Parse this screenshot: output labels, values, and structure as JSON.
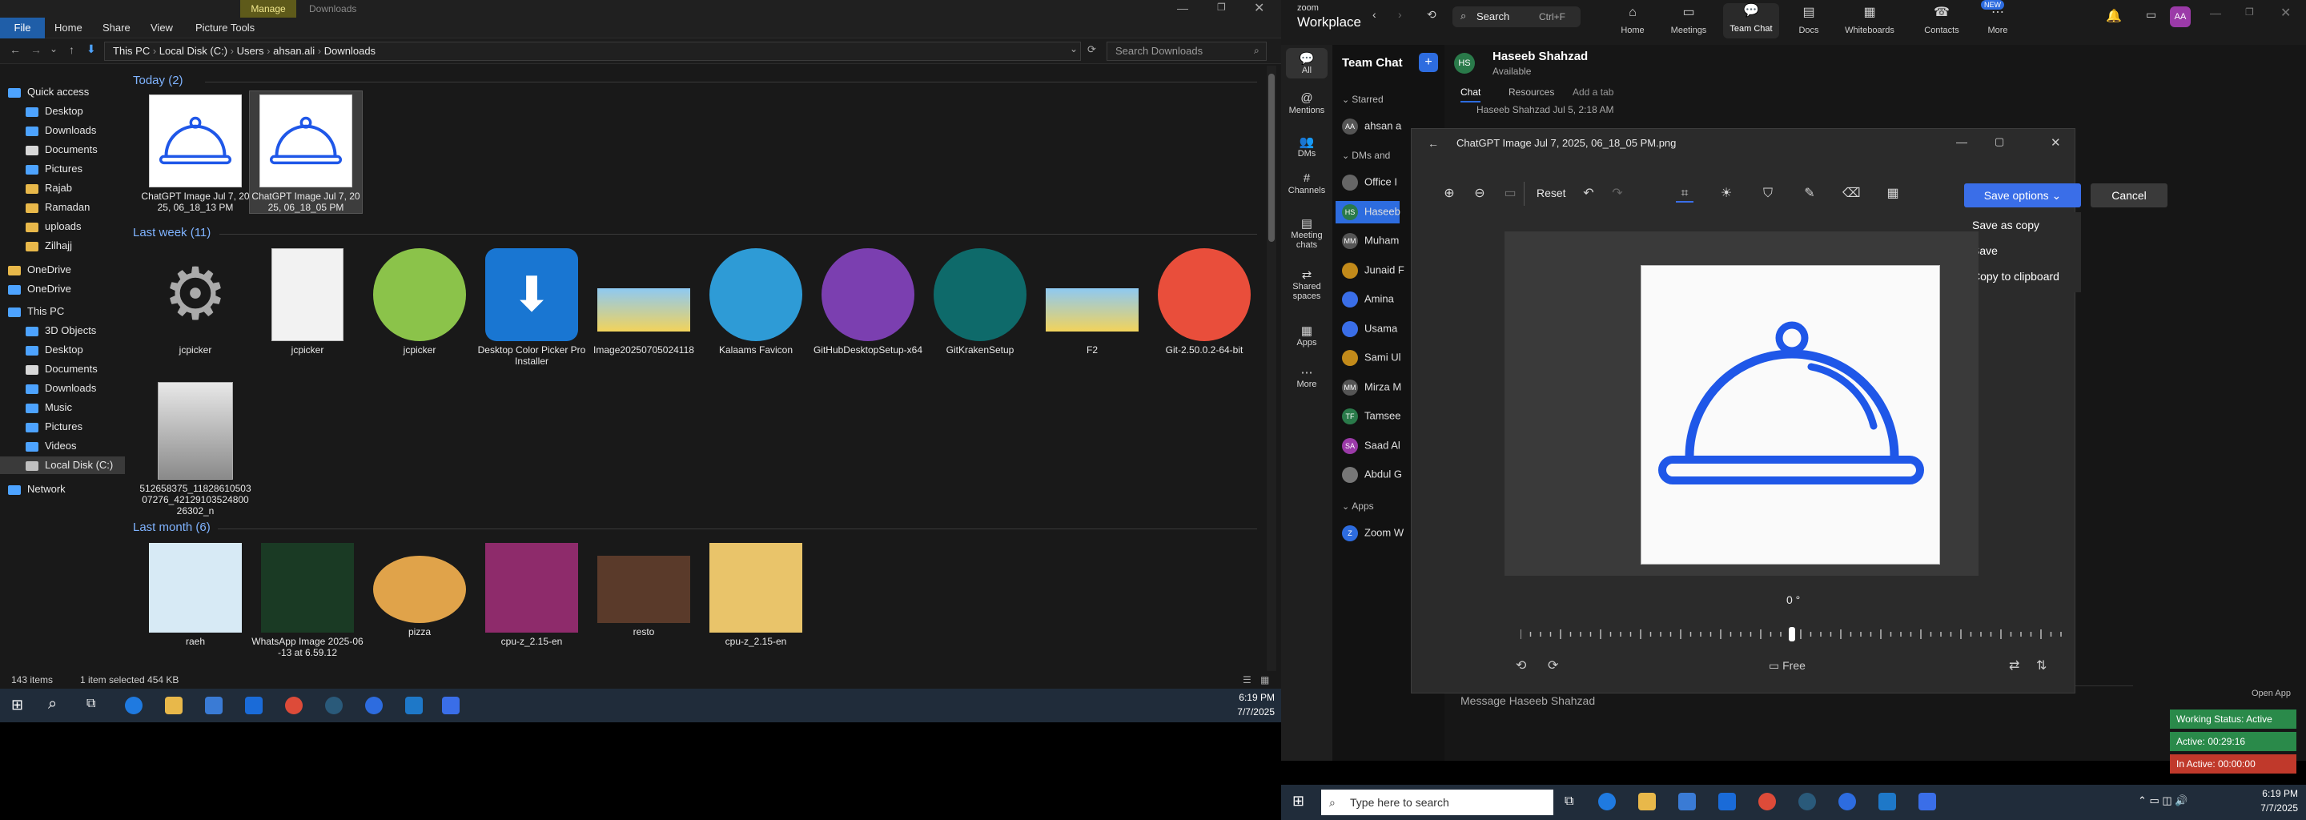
{
  "explorer": {
    "window_title": "Downloads",
    "ribbon_highlight": "Manage",
    "tabs": [
      "File",
      "Home",
      "Share",
      "View",
      "Picture Tools"
    ],
    "address": [
      "This PC",
      "Local Disk (C:)",
      "Users",
      "ahsan.ali",
      "Downloads"
    ],
    "search_placeholder": "Search Downloads",
    "nav": [
      {
        "label": "Quick access",
        "color": "#4da3ff"
      },
      {
        "label": "Desktop",
        "color": "#4da3ff"
      },
      {
        "label": "Downloads",
        "color": "#4da3ff"
      },
      {
        "label": "Documents",
        "color": "#d8d8d8"
      },
      {
        "label": "Pictures",
        "color": "#4da3ff"
      },
      {
        "label": "Rajab",
        "color": "#e8b84a"
      },
      {
        "label": "Ramadan",
        "color": "#e8b84a"
      },
      {
        "label": "uploads",
        "color": "#e8b84a"
      },
      {
        "label": "Zilhajj",
        "color": "#e8b84a"
      },
      {
        "label": "OneDrive",
        "color": "#e8b84a"
      },
      {
        "label": "OneDrive",
        "color": "#4da3ff"
      },
      {
        "label": "This PC",
        "color": "#4da3ff"
      },
      {
        "label": "3D Objects",
        "color": "#4da3ff"
      },
      {
        "label": "Desktop",
        "color": "#4da3ff"
      },
      {
        "label": "Documents",
        "color": "#d8d8d8"
      },
      {
        "label": "Downloads",
        "color": "#4da3ff"
      },
      {
        "label": "Music",
        "color": "#4da3ff"
      },
      {
        "label": "Pictures",
        "color": "#4da3ff"
      },
      {
        "label": "Videos",
        "color": "#4da3ff"
      },
      {
        "label": "Local Disk (C:)",
        "color": "#bfbfbf"
      },
      {
        "label": "Network",
        "color": "#4da3ff"
      }
    ],
    "groups": [
      {
        "title": "Today (2)"
      },
      {
        "title": "Last week (11)"
      },
      {
        "title": "Last month (6)"
      }
    ],
    "files_today": [
      {
        "name": "ChatGPT Image Jul 7, 2025, 06_18_13 PM"
      },
      {
        "name": "ChatGPT Image Jul 7, 2025, 06_18_05 PM"
      }
    ],
    "files_lastweek": [
      {
        "name": "jcpicker",
        "icon": "gear-icon"
      },
      {
        "name": "jcpicker",
        "icon": "doc-icon"
      },
      {
        "name": "jcpicker",
        "icon": "chameleon-icon"
      },
      {
        "name": "Desktop Color Picker Pro Installer",
        "icon": "installer-icon"
      },
      {
        "name": "Image20250705024118",
        "icon": "image-icon"
      },
      {
        "name": "Kalaams Favicon",
        "icon": "edge-icon"
      },
      {
        "name": "GitHubDesktopSetup-x64",
        "icon": "github-icon"
      },
      {
        "name": "GitKrakenSetup",
        "icon": "gitkraken-icon"
      },
      {
        "name": "F2",
        "icon": "image-icon"
      },
      {
        "name": "Git-2.50.0.2-64-bit",
        "icon": "git-icon"
      },
      {
        "name": "512658375_1182861050307276_4212910352480026302_n",
        "icon": "photo-icon"
      }
    ],
    "files_lastmonth": [
      {
        "name": "raeh"
      },
      {
        "name": "WhatsApp Image 2025-06-13 at 6.59.12"
      },
      {
        "name": "pizza"
      },
      {
        "name": "cpu-z_2.15-en"
      },
      {
        "name": "resto"
      },
      {
        "name": "cpu-z_2.15-en"
      }
    ],
    "status_left": "143 items",
    "status_mid": "1 item selected  454 KB"
  },
  "taskbar1": {
    "time": "6:19 PM",
    "date": "7/7/2025"
  },
  "zoom": {
    "brand_top": "zoom",
    "brand": "Workplace",
    "search": "Search",
    "search_shortcut": "Ctrl+F",
    "nav": [
      "Home",
      "Meetings",
      "Team Chat",
      "Docs",
      "Whiteboards",
      "Contacts",
      "More"
    ],
    "new_badge": "NEW",
    "profile_initials": "AA",
    "left_nav": [
      "All",
      "Mentions",
      "DMs",
      "Channels",
      "Meeting chats",
      "Shared spaces",
      "Apps",
      "More"
    ],
    "team_chat_title": "Team Chat",
    "starred": "Starred",
    "starred_user": "ahsan a",
    "dms_header": "DMs and",
    "contacts": [
      {
        "name": "Office I",
        "initials": "",
        "color": "#666"
      },
      {
        "name": "Haseeb",
        "initials": "HS",
        "color": "#2a7a4a"
      },
      {
        "name": "Muham",
        "initials": "MM",
        "color": "#555"
      },
      {
        "name": "Junaid F",
        "initials": "",
        "color": "#c28a1a"
      },
      {
        "name": "Amina",
        "initials": "",
        "color": "#3a6ee8"
      },
      {
        "name": "Usama",
        "initials": "",
        "color": "#3a6ee8"
      },
      {
        "name": "Sami Ul",
        "initials": "",
        "color": "#c28a1a"
      },
      {
        "name": "Mirza M",
        "initials": "MM",
        "color": "#555"
      },
      {
        "name": "Tamsee",
        "initials": "TF",
        "color": "#2a7a4a"
      },
      {
        "name": "Saad Al",
        "initials": "SA",
        "color": "#9b3aa8"
      },
      {
        "name": "Abdul G",
        "initials": "",
        "color": "#777"
      }
    ],
    "apps_header": "Apps",
    "apps_item": "Zoom W",
    "chat_user": "Haseeb Shahzad",
    "chat_user_status": "Available",
    "chat_tabs": [
      "Chat",
      "Resources",
      "Add a tab"
    ],
    "last_msg": "Haseeb Shahzad Jul 5, 2:18 AM",
    "message_placeholder": "Message Haseeb Shahzad",
    "open_app": "Open App",
    "working_status": "Working Status: Active",
    "active_time": "Active: 00:29:16",
    "inactive_time": "In Active: 00:00:00"
  },
  "editor": {
    "title": "ChatGPT Image Jul 7, 2025, 06_18_05 PM.png",
    "reset": "Reset",
    "save_options": "Save options",
    "cancel": "Cancel",
    "menu": [
      "Save as copy",
      "Save",
      "Copy to clipboard"
    ],
    "rotation": "0 °",
    "aspect": "Free"
  },
  "taskbar2": {
    "search": "Type here to search",
    "time": "6:19 PM",
    "date": "7/7/2025"
  }
}
